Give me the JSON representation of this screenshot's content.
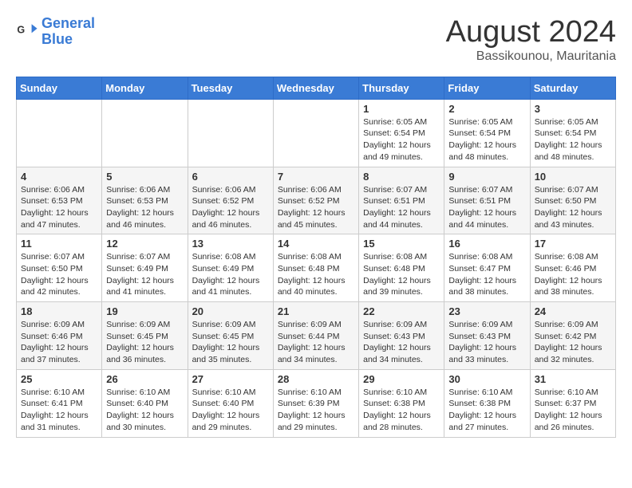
{
  "header": {
    "logo_line1": "General",
    "logo_line2": "Blue",
    "month": "August 2024",
    "location": "Bassikounou, Mauritania"
  },
  "weekdays": [
    "Sunday",
    "Monday",
    "Tuesday",
    "Wednesday",
    "Thursday",
    "Friday",
    "Saturday"
  ],
  "weeks": [
    [
      {
        "day": "",
        "info": ""
      },
      {
        "day": "",
        "info": ""
      },
      {
        "day": "",
        "info": ""
      },
      {
        "day": "",
        "info": ""
      },
      {
        "day": "1",
        "info": "Sunrise: 6:05 AM\nSunset: 6:54 PM\nDaylight: 12 hours\nand 49 minutes."
      },
      {
        "day": "2",
        "info": "Sunrise: 6:05 AM\nSunset: 6:54 PM\nDaylight: 12 hours\nand 48 minutes."
      },
      {
        "day": "3",
        "info": "Sunrise: 6:05 AM\nSunset: 6:54 PM\nDaylight: 12 hours\nand 48 minutes."
      }
    ],
    [
      {
        "day": "4",
        "info": "Sunrise: 6:06 AM\nSunset: 6:53 PM\nDaylight: 12 hours\nand 47 minutes."
      },
      {
        "day": "5",
        "info": "Sunrise: 6:06 AM\nSunset: 6:53 PM\nDaylight: 12 hours\nand 46 minutes."
      },
      {
        "day": "6",
        "info": "Sunrise: 6:06 AM\nSunset: 6:52 PM\nDaylight: 12 hours\nand 46 minutes."
      },
      {
        "day": "7",
        "info": "Sunrise: 6:06 AM\nSunset: 6:52 PM\nDaylight: 12 hours\nand 45 minutes."
      },
      {
        "day": "8",
        "info": "Sunrise: 6:07 AM\nSunset: 6:51 PM\nDaylight: 12 hours\nand 44 minutes."
      },
      {
        "day": "9",
        "info": "Sunrise: 6:07 AM\nSunset: 6:51 PM\nDaylight: 12 hours\nand 44 minutes."
      },
      {
        "day": "10",
        "info": "Sunrise: 6:07 AM\nSunset: 6:50 PM\nDaylight: 12 hours\nand 43 minutes."
      }
    ],
    [
      {
        "day": "11",
        "info": "Sunrise: 6:07 AM\nSunset: 6:50 PM\nDaylight: 12 hours\nand 42 minutes."
      },
      {
        "day": "12",
        "info": "Sunrise: 6:07 AM\nSunset: 6:49 PM\nDaylight: 12 hours\nand 41 minutes."
      },
      {
        "day": "13",
        "info": "Sunrise: 6:08 AM\nSunset: 6:49 PM\nDaylight: 12 hours\nand 41 minutes."
      },
      {
        "day": "14",
        "info": "Sunrise: 6:08 AM\nSunset: 6:48 PM\nDaylight: 12 hours\nand 40 minutes."
      },
      {
        "day": "15",
        "info": "Sunrise: 6:08 AM\nSunset: 6:48 PM\nDaylight: 12 hours\nand 39 minutes."
      },
      {
        "day": "16",
        "info": "Sunrise: 6:08 AM\nSunset: 6:47 PM\nDaylight: 12 hours\nand 38 minutes."
      },
      {
        "day": "17",
        "info": "Sunrise: 6:08 AM\nSunset: 6:46 PM\nDaylight: 12 hours\nand 38 minutes."
      }
    ],
    [
      {
        "day": "18",
        "info": "Sunrise: 6:09 AM\nSunset: 6:46 PM\nDaylight: 12 hours\nand 37 minutes."
      },
      {
        "day": "19",
        "info": "Sunrise: 6:09 AM\nSunset: 6:45 PM\nDaylight: 12 hours\nand 36 minutes."
      },
      {
        "day": "20",
        "info": "Sunrise: 6:09 AM\nSunset: 6:45 PM\nDaylight: 12 hours\nand 35 minutes."
      },
      {
        "day": "21",
        "info": "Sunrise: 6:09 AM\nSunset: 6:44 PM\nDaylight: 12 hours\nand 34 minutes."
      },
      {
        "day": "22",
        "info": "Sunrise: 6:09 AM\nSunset: 6:43 PM\nDaylight: 12 hours\nand 34 minutes."
      },
      {
        "day": "23",
        "info": "Sunrise: 6:09 AM\nSunset: 6:43 PM\nDaylight: 12 hours\nand 33 minutes."
      },
      {
        "day": "24",
        "info": "Sunrise: 6:09 AM\nSunset: 6:42 PM\nDaylight: 12 hours\nand 32 minutes."
      }
    ],
    [
      {
        "day": "25",
        "info": "Sunrise: 6:10 AM\nSunset: 6:41 PM\nDaylight: 12 hours\nand 31 minutes."
      },
      {
        "day": "26",
        "info": "Sunrise: 6:10 AM\nSunset: 6:40 PM\nDaylight: 12 hours\nand 30 minutes."
      },
      {
        "day": "27",
        "info": "Sunrise: 6:10 AM\nSunset: 6:40 PM\nDaylight: 12 hours\nand 29 minutes."
      },
      {
        "day": "28",
        "info": "Sunrise: 6:10 AM\nSunset: 6:39 PM\nDaylight: 12 hours\nand 29 minutes."
      },
      {
        "day": "29",
        "info": "Sunrise: 6:10 AM\nSunset: 6:38 PM\nDaylight: 12 hours\nand 28 minutes."
      },
      {
        "day": "30",
        "info": "Sunrise: 6:10 AM\nSunset: 6:38 PM\nDaylight: 12 hours\nand 27 minutes."
      },
      {
        "day": "31",
        "info": "Sunrise: 6:10 AM\nSunset: 6:37 PM\nDaylight: 12 hours\nand 26 minutes."
      }
    ]
  ]
}
